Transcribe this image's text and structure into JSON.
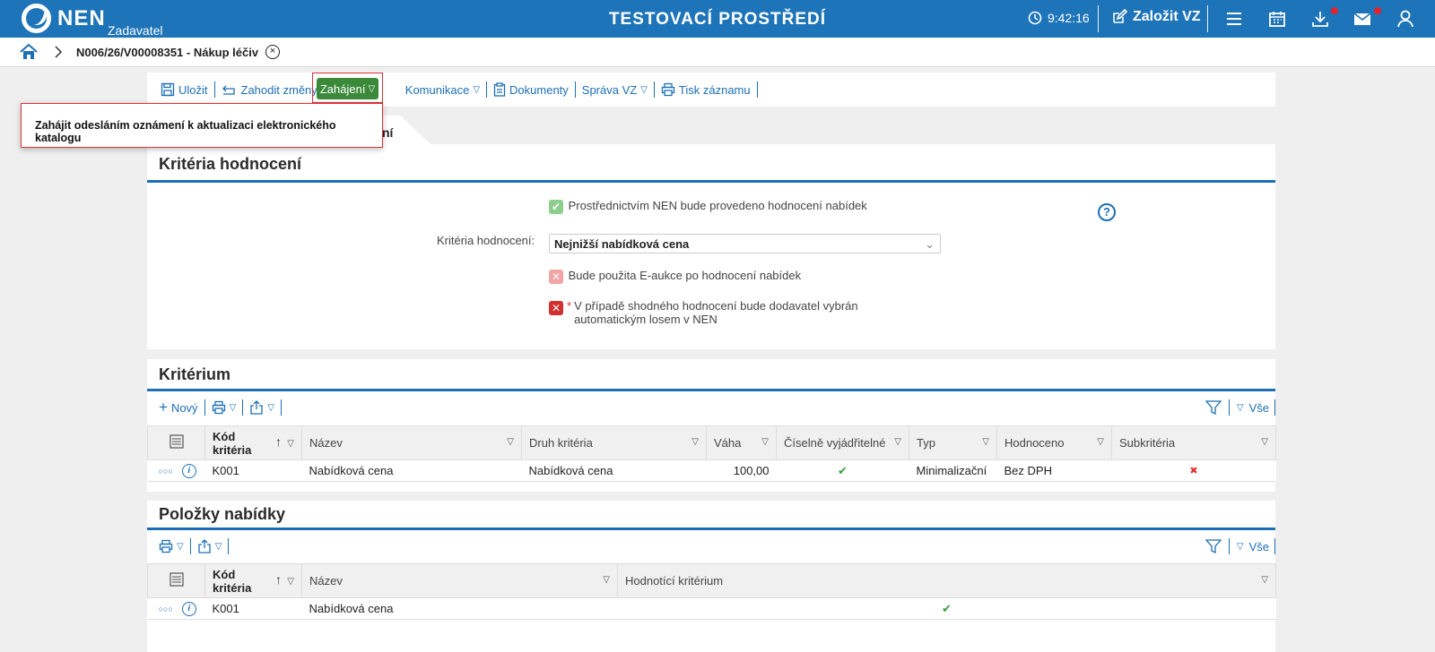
{
  "header": {
    "logo_text": "NEN",
    "logo_sub": "Zadavatel",
    "env_title": "TESTOVACÍ PROSTŘEDÍ",
    "time": "9:42:16",
    "create_label": "Založit VZ"
  },
  "breadcrumb": {
    "record": "N006/26/V00008351 - Nákup léčiv",
    "close": "×"
  },
  "toolbar": {
    "save": "Uložit",
    "discard": "Zahodit změny",
    "start": "Zahájení",
    "communication": "Komunikace",
    "documents": "Dokumenty",
    "management": "Správa VZ",
    "print": "Tisk záznamu"
  },
  "tooltip": {
    "text": "Zahájit odesláním oznámení k aktualizaci elektronického katalogu"
  },
  "tab_partial": "ní",
  "evaluation": {
    "title": "Kritéria hodnocení",
    "nen_eval_label": "Prostřednictvím NEN bude provedeno hodnocení nabídek",
    "criteria_label": "Kritéria hodnocení:",
    "criteria_value": "Nejnižší nabídková cena",
    "eauction_label": "Bude použita E-aukce po hodnocení nabídek",
    "required_mark": "*",
    "tie_label": "V případě shodného hodnocení bude dodavatel vybrán automatickým losem v NEN",
    "help": "?"
  },
  "criterion": {
    "title": "Kritérium",
    "new_label": "Nový",
    "all_label": "Vše",
    "columns": [
      "Kód kritéria",
      "Název",
      "Druh kritéria",
      "Váha",
      "Číselně vyjádřitelné",
      "Typ",
      "Hodnoceno",
      "Subkritéria"
    ],
    "rows": [
      {
        "code": "K001",
        "name": "Nabídková cena",
        "kind": "Nabídková cena",
        "weight": "100,00",
        "numeric": "✔",
        "type": "Minimalizační",
        "evaluated": "Bez DPH",
        "sub": "✖"
      }
    ]
  },
  "items": {
    "title": "Položky nabídky",
    "all_label": "Vše",
    "columns": [
      "Kód kritéria",
      "Název",
      "Hodnotící kritérium"
    ],
    "rows": [
      {
        "code": "K001",
        "name": "Nabídková cena",
        "criterion": "✔"
      }
    ]
  },
  "colors": {
    "brand": "#1d74b9",
    "link": "#1d6fb5",
    "start_button": "#3a8a3a",
    "highlight": "#dd3333"
  }
}
